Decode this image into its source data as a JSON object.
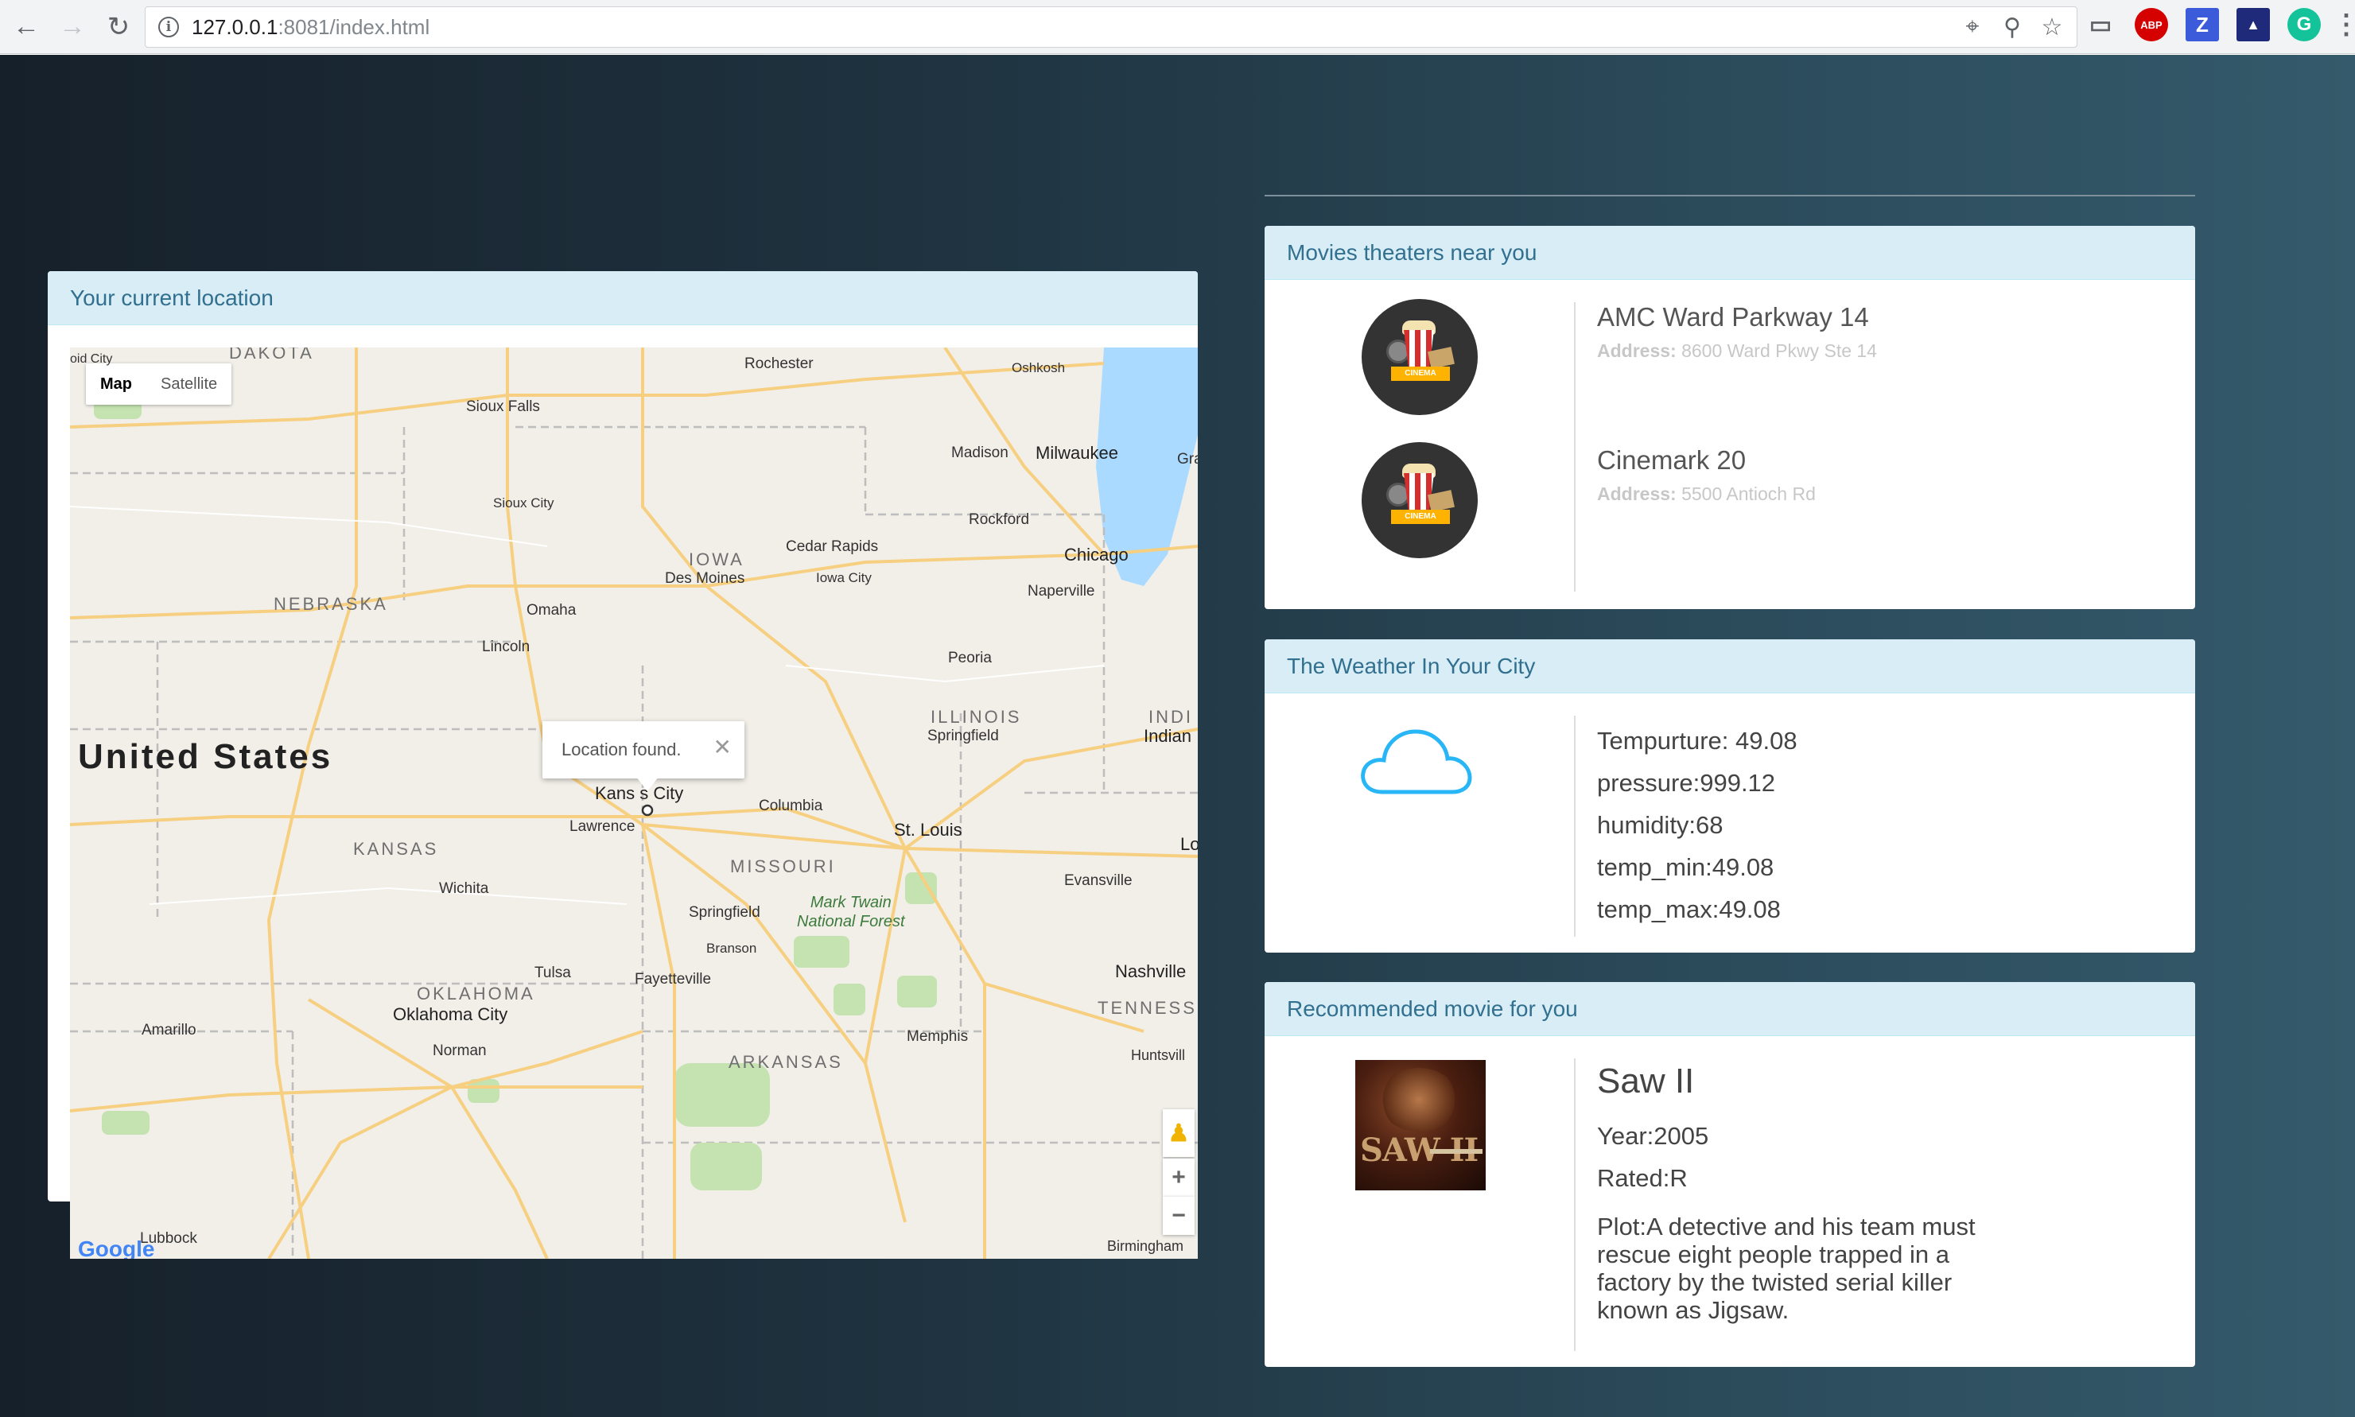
{
  "browser": {
    "url_host": "127.0.0.1",
    "url_rest": ":8081/index.html"
  },
  "map_panel": {
    "heading": "Your current location",
    "map_type": {
      "map": "Map",
      "satellite": "Satellite"
    },
    "info_window": "Location found.",
    "labels": {
      "dakota": "DAKOTA",
      "rochester": "Rochester",
      "oshkosh": "Oshkosh",
      "sioux_falls": "Sioux Falls",
      "madison": "Madison",
      "milwaukee": "Milwaukee",
      "gra": "Gra",
      "sioux_city": "Sioux City",
      "rockford": "Rockford",
      "cedar_rapids": "Cedar Rapids",
      "iowa": "IOWA",
      "chicago": "Chicago",
      "des_moines": "Des Moines",
      "iowa_city": "Iowa City",
      "naperville": "Naperville",
      "nebraska": "NEBRASKA",
      "omaha": "Omaha",
      "lincoln": "Lincoln",
      "peoria": "Peoria",
      "illinois": "ILLINOIS",
      "indi": "INDI",
      "springfield_il": "Springfield",
      "indian": "Indian",
      "united_states": "United States",
      "kansas_city": "Kans  s City",
      "columbia": "Columbia",
      "lawrence": "Lawrence",
      "st_louis": "St. Louis",
      "kansas": "KANSAS",
      "missouri": "MISSOURI",
      "lo": "Lo",
      "evansville": "Evansville",
      "wichita": "Wichita",
      "mark_twain": "Mark Twain\nNational Forest",
      "springfield_mo": "Springfield",
      "branson": "Branson",
      "tulsa": "Tulsa",
      "fayetteville": "Fayetteville",
      "nashville": "Nashville",
      "oklahoma": "OKLAHOMA",
      "oklahoma_city": "Oklahoma City",
      "tennessee": "TENNESS",
      "amarillo": "Amarillo",
      "memphis": "Memphis",
      "norman": "Norman",
      "arkansas": "ARKANSAS",
      "huntsville": "Huntsvill",
      "lubbock": "Lubbock",
      "birmingham": "Birmingham",
      "google": "Google",
      "top_left": "oid City"
    }
  },
  "theaters": {
    "heading": "Movies theaters near you",
    "badge_text": "CINEMA",
    "address_label": "Address:",
    "items": [
      {
        "name": "AMC Ward Parkway 14",
        "address": "8600 Ward Pkwy Ste 14"
      },
      {
        "name": "Cinemark 20",
        "address": "5500 Antioch Rd"
      }
    ]
  },
  "weather": {
    "heading": "The Weather In Your City",
    "icon": "cloud-icon",
    "lines": [
      "Tempurture: 49.08",
      "pressure:999.12",
      "humidity:68",
      "temp_min:49.08",
      "temp_max:49.08"
    ]
  },
  "movie": {
    "heading": "Recommended movie for you",
    "poster_text": "SAW II",
    "title": "Saw II",
    "year": "Year:2005",
    "rated": "Rated:R",
    "plot": "Plot:A detective and his team must rescue eight people trapped in a factory by the twisted serial killer known as Jigsaw."
  },
  "colors": {
    "panel_heading_bg": "#d9edf7",
    "panel_heading_text": "#31708f",
    "cloud": "#29b6f6",
    "page_bg_dark": "#16202a",
    "page_bg_light": "#345a6b"
  }
}
